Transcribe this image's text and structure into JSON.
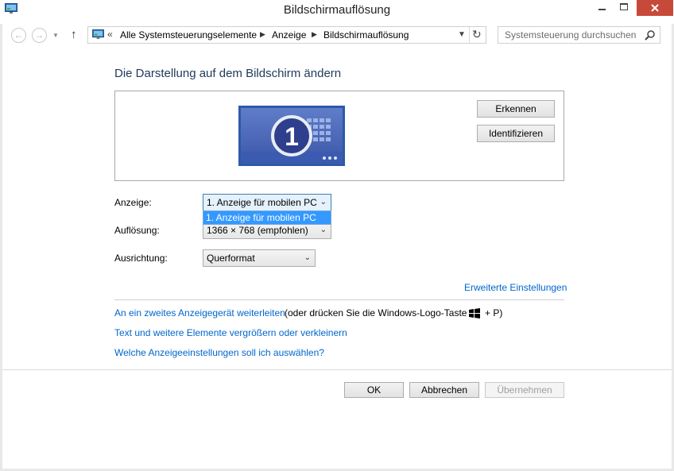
{
  "window": {
    "title": "Bildschirmauflösung"
  },
  "address_bar": {
    "separator": "«",
    "breadcrumbs": [
      "Alle Systemsteuerungselemente",
      "Anzeige",
      "Bildschirmauflösung"
    ]
  },
  "search": {
    "placeholder": "Systemsteuerung durchsuchen"
  },
  "main": {
    "heading": "Die Darstellung auf dem Bildschirm ändern",
    "monitor_number": "1",
    "detect_label": "Erkennen",
    "identify_label": "Identifizieren",
    "display_label": "Anzeige:",
    "display_value": "1. Anzeige für mobilen PC",
    "display_options": [
      "1. Anzeige für mobilen PC"
    ],
    "resolution_label": "Auflösung:",
    "resolution_value": "1366 × 768 (empfohlen)",
    "orientation_label": "Ausrichtung:",
    "orientation_value": "Querformat",
    "advanced_link": "Erweiterte Einstellungen",
    "second_display_link": "An ein zweites Anzeigegerät weiterleiten",
    "second_display_suffix": "(oder drücken Sie die Windows-Logo-Taste",
    "second_display_tail": "+ P)",
    "text_size_link": "Text und weitere Elemente vergrößern oder verkleinern",
    "which_settings_link": "Welche Anzeigeeinstellungen soll ich auswählen?"
  },
  "footer": {
    "ok_label": "OK",
    "cancel_label": "Abbrechen",
    "apply_label": "Übernehmen"
  },
  "colors": {
    "heading": "#1e395b",
    "link": "#0066cc",
    "close_button": "#c7493a",
    "selection": "#3399ff"
  }
}
